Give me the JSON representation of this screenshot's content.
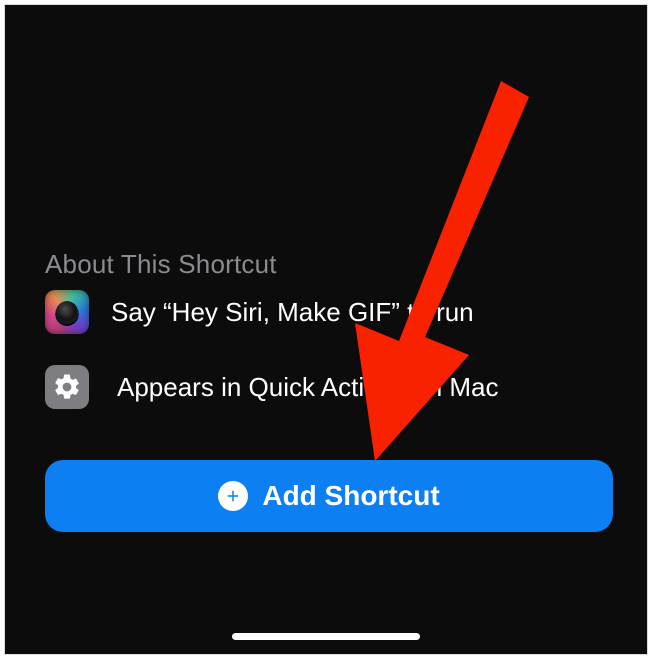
{
  "section": {
    "title": "About This Shortcut"
  },
  "rows": {
    "siri_text": "Say “Hey Siri, Make GIF” to run",
    "quick_actions_text": "Appears in Quick Actions on Mac"
  },
  "button": {
    "add_label": "Add Shortcut"
  },
  "colors": {
    "accent": "#0c7ff2",
    "arrow": "#f82200"
  },
  "annotation": {
    "arrow_direction": "down-left",
    "arrow_target": "add-shortcut-button"
  }
}
